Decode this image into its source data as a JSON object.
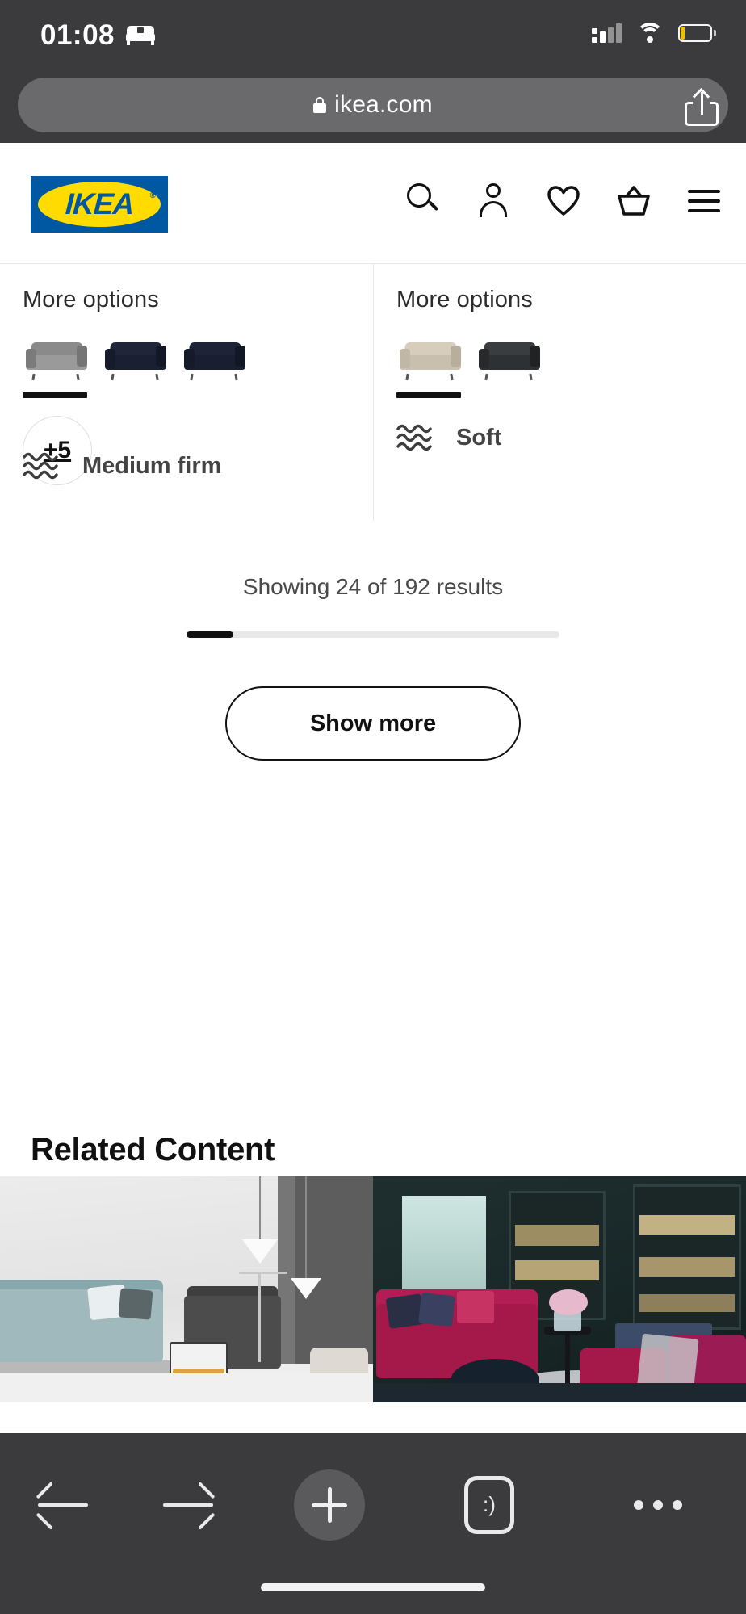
{
  "status_bar": {
    "time": "01:08",
    "bed_icon": "bed-icon",
    "signal_icon": "signal-bars-icon",
    "wifi_icon": "wifi-icon",
    "battery_icon": "battery-low-icon"
  },
  "url_bar": {
    "lock_icon": "lock-icon",
    "url": "ikea.com",
    "share_icon": "share-icon"
  },
  "site_header": {
    "logo_text": "IKEA",
    "logo_registered": "®",
    "logo_bg": "#0058a3",
    "logo_oval": "#ffdb00",
    "icons": [
      {
        "name": "search-icon",
        "label": "Search"
      },
      {
        "name": "account-icon",
        "label": "Account"
      },
      {
        "name": "favourites-heart-icon",
        "label": "Favourites"
      },
      {
        "name": "shopping-basket-icon",
        "label": "Basket"
      },
      {
        "name": "hamburger-menu-icon",
        "label": "Menu"
      }
    ]
  },
  "option_cards": [
    {
      "title": "More options",
      "thumbnails": [
        {
          "name": "sofa-thumb-grey",
          "color": "#7c7c7c",
          "dark": "#6a6a6a",
          "selected": true
        },
        {
          "name": "sofa-thumb-navy",
          "color": "#1d2235",
          "dark": "#151a2a",
          "selected": false
        },
        {
          "name": "sofa-thumb-navy-2",
          "color": "#1a1f30",
          "dark": "#131826",
          "selected": false
        }
      ],
      "extra_badge": "+5",
      "firmness_icon": "firmness-wave-icon",
      "firmness_label": "Medium firm"
    },
    {
      "title": "More options",
      "thumbnails": [
        {
          "name": "sofa-thumb-beige",
          "color": "#cdc4b4",
          "dark": "#b8ae9c",
          "selected": true
        },
        {
          "name": "sofa-thumb-dark-grey",
          "color": "#35383a",
          "dark": "#26292b",
          "selected": false
        }
      ],
      "extra_badge": null,
      "firmness_icon": "firmness-wave-icon",
      "firmness_label": "Soft"
    }
  ],
  "results": {
    "showing_text": "Showing 24 of 192 results",
    "shown_count": 24,
    "total_count": 192,
    "progress_percent": 12.5,
    "show_more_label": "Show more"
  },
  "related": {
    "heading": "Related Content",
    "items": [
      {
        "name": "related-image-light-living-room",
        "alt": "Light grey living room with blue sofa and dark armchair"
      },
      {
        "name": "related-image-dark-living-room",
        "alt": "Dark green library living room with pink sofa and armchair"
      }
    ]
  },
  "bottom_toolbar": {
    "back_icon": "back-arrow-icon",
    "forward_icon": "forward-arrow-icon",
    "new_tab_icon": "plus-icon",
    "tabs_icon": "tabs-icon",
    "tabs_glyph": ":)",
    "more_icon": "more-ellipsis-icon",
    "home_indicator": "home-indicator"
  }
}
